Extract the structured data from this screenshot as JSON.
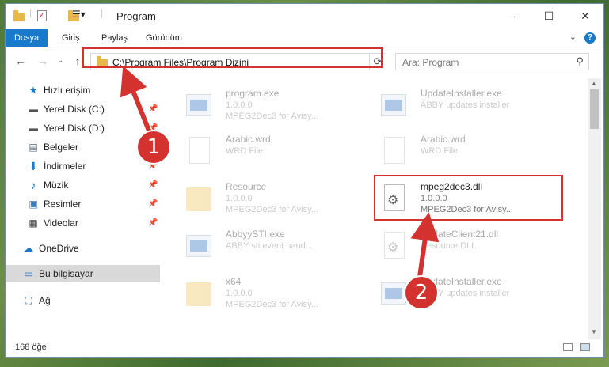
{
  "window": {
    "title": "Program"
  },
  "ribbon": {
    "tabs": [
      "Dosya",
      "Giriş",
      "Paylaş",
      "Görünüm"
    ],
    "help": "?"
  },
  "nav": {
    "back": "←",
    "forward": "→",
    "recent": "⌄",
    "up": "↑",
    "address": "C:\\Program Files\\Program Dizini",
    "search_placeholder": "Ara: Program"
  },
  "sidebar": {
    "items": [
      {
        "label": "Hızlı erişim",
        "icon": "star-icon"
      },
      {
        "label": "Yerel Disk (C:)",
        "icon": "drive-icon",
        "pinned": true
      },
      {
        "label": "Yerel Disk (D:)",
        "icon": "drive-icon",
        "pinned": true
      },
      {
        "label": "Belgeler",
        "icon": "documents-icon",
        "pinned": true
      },
      {
        "label": "İndirmeler",
        "icon": "download-icon",
        "pinned": true
      },
      {
        "label": "Müzik",
        "icon": "music-icon",
        "pinned": true
      },
      {
        "label": "Resimler",
        "icon": "pictures-icon",
        "pinned": true
      },
      {
        "label": "Videolar",
        "icon": "video-icon",
        "pinned": true
      },
      {
        "label": "OneDrive",
        "icon": "cloud-icon"
      },
      {
        "label": "Bu bilgisayar",
        "icon": "computer-icon",
        "selected": true
      },
      {
        "label": "Ağ",
        "icon": "network-icon"
      }
    ]
  },
  "files": [
    {
      "name": "program.exe",
      "line2": "1.0.0.0",
      "line3": "MPEG2Dec3 for Avisy...",
      "type": "exe"
    },
    {
      "name": "UpdateInstaller.exe",
      "line2": "ABBY updates installer",
      "line3": "",
      "type": "exe"
    },
    {
      "name": "Arabic.wrd",
      "line2": "WRD File",
      "line3": "",
      "type": "doc"
    },
    {
      "name": "Arabic.wrd",
      "line2": "WRD File",
      "line3": "",
      "type": "doc"
    },
    {
      "name": "Resource",
      "line2": "1.0.0.0",
      "line3": "MPEG2Dec3 for Avisy...",
      "type": "folder"
    },
    {
      "name": "mpeg2dec3.dll",
      "line2": "1.0.0.0",
      "line3": "MPEG2Dec3 for Avisy...",
      "type": "dll",
      "highlighted": true
    },
    {
      "name": "AbbyySTI.exe",
      "line2": "ABBY sti event hand...",
      "line3": "",
      "type": "exe"
    },
    {
      "name": "UpdateClient21.dll",
      "line2": "Resource DLL",
      "line3": "",
      "type": "dll"
    },
    {
      "name": "x64",
      "line2": "1.0.0.0",
      "line3": "MPEG2Dec3 for Avisy...",
      "type": "folder"
    },
    {
      "name": "UpdateInstaller.exe",
      "line2": "ABBY updates installer",
      "line3": "",
      "type": "exe"
    }
  ],
  "status": {
    "count": "168 öğe"
  },
  "callouts": {
    "one": "1",
    "two": "2"
  },
  "colors": {
    "accent": "#1979ca",
    "highlight": "#d4322f"
  }
}
